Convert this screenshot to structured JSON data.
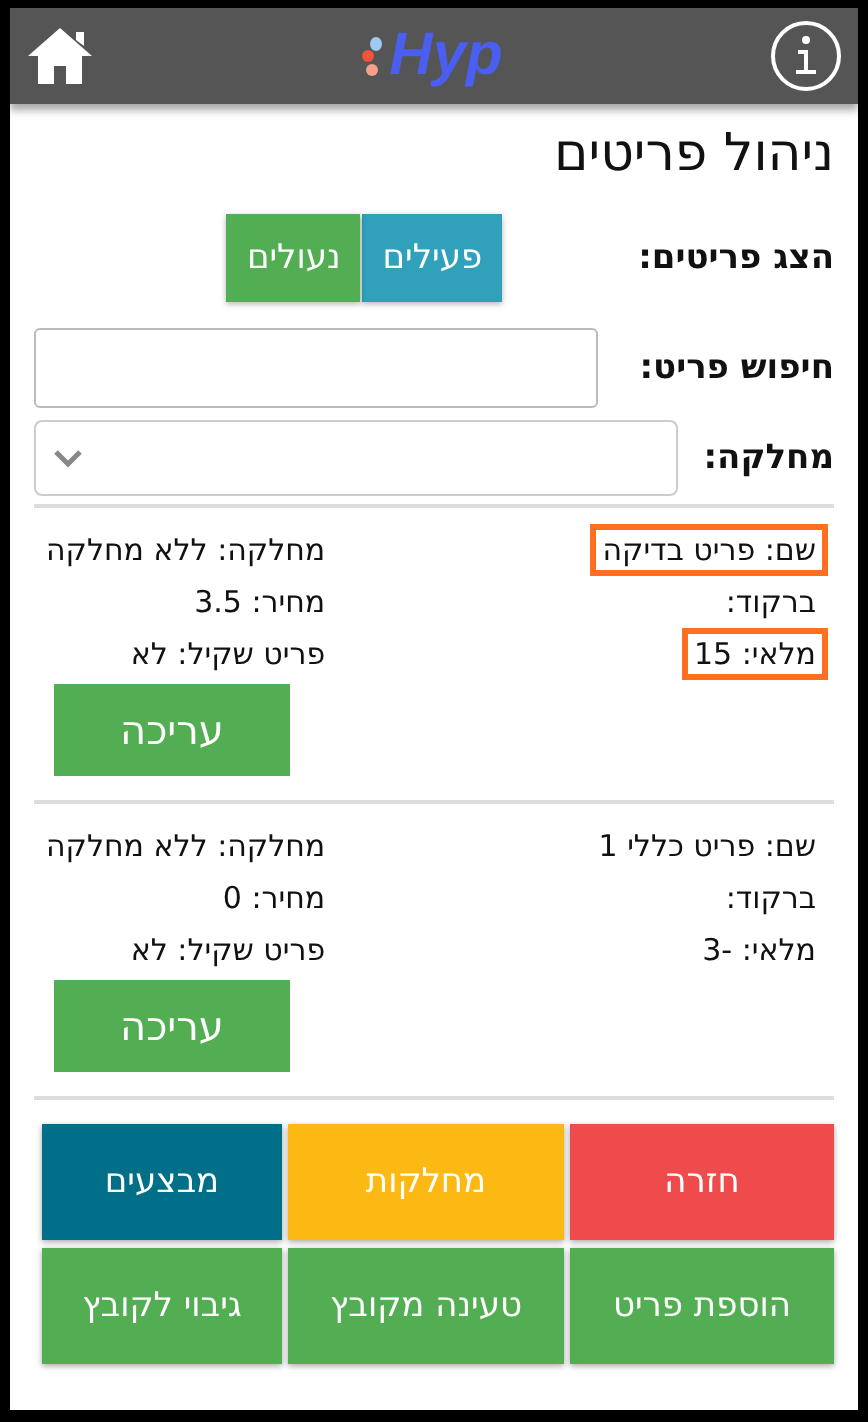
{
  "top_bar": {
    "logo": "Hyp"
  },
  "title": "ניהול פריטים",
  "show_filter": {
    "label": "הצג פריטים:",
    "options": [
      {
        "label": "פעילים",
        "selected": true
      },
      {
        "label": "נעולים",
        "selected": false
      }
    ]
  },
  "search": {
    "label": "חיפוש פריט:"
  },
  "category": {
    "label": "מחלקה:"
  },
  "items": [
    {
      "right": [
        {
          "text": "שם: פריט בדיקה",
          "highlighted": true
        },
        {
          "text": "ברקוד:",
          "highlighted": false
        },
        {
          "text": "מלאי: 15",
          "highlighted": true
        }
      ],
      "left": [
        "מחלקה: ללא מחלקה",
        "מחיר: 3.5",
        "פריט שקיל: לא"
      ],
      "button": "עריכה"
    },
    {
      "right": [
        {
          "text": "שם: פריט כללי 1",
          "highlighted": false
        },
        {
          "text": "ברקוד:",
          "highlighted": false
        },
        {
          "text": "מלאי: -3",
          "highlighted": false
        }
      ],
      "left": [
        "מחלקה: ללא מחלקה",
        "מחיר: 0",
        "פריט שקיל: לא"
      ],
      "button": "עריכה"
    }
  ],
  "actions": [
    {
      "label": "חזרה",
      "color": "#f04b4c"
    },
    {
      "label": "מחלקות",
      "color": "#fdb913"
    },
    {
      "label": "מבצעים",
      "color": "#006f87"
    },
    {
      "label": "הוספת פריט",
      "color": "#53ad53"
    },
    {
      "label": "טעינה מקובץ",
      "color": "#53ad53"
    },
    {
      "label": "גיבוי לקובץ",
      "color": "#53ad53"
    }
  ]
}
